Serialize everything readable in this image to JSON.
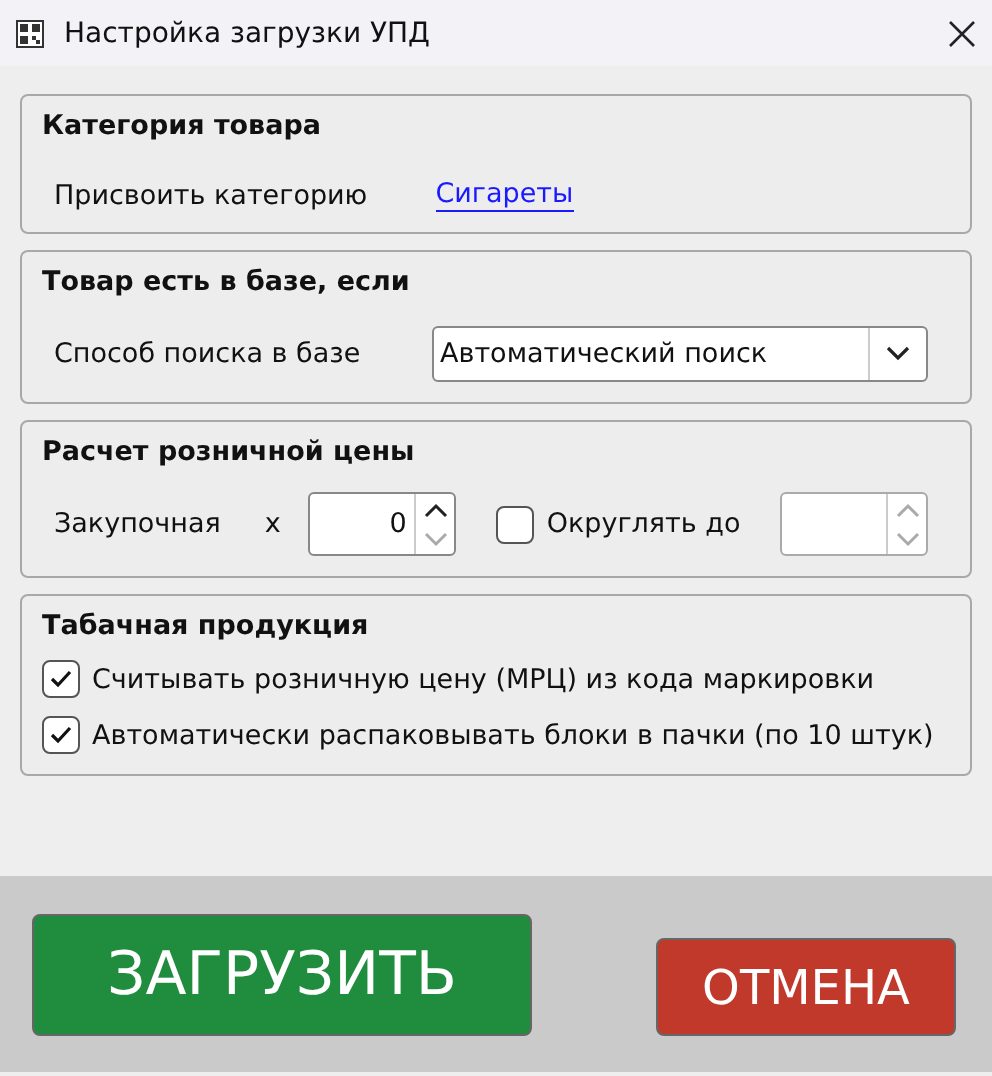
{
  "window": {
    "title": "Настройка загрузки УПД"
  },
  "sections": [
    {
      "title": "Категория товара",
      "kind": "link",
      "label": "Присвоить категорию",
      "link": "Сигареты"
    },
    {
      "title": "Товар есть в базе, если",
      "kind": "dropdown",
      "label": "Способ поиска в базе",
      "value": "Автоматический поиск"
    },
    {
      "title": "Расчет розничной цены",
      "kind": "price",
      "label": "Закупочная",
      "operator": "x",
      "multiplier": {
        "value": "0",
        "disabled": false
      },
      "round": {
        "label": "Округлять до",
        "checked": false,
        "disabled": true
      }
    },
    {
      "title": "Табачная продукция",
      "kind": "checks",
      "options": [
        {
          "label": "Считывать розничную цену (МРЦ) из кода маркировки",
          "checked": true
        },
        {
          "label": "Автоматически распаковывать блоки в пачки (по 10 штук)",
          "checked": true
        }
      ]
    }
  ],
  "buttons": [
    {
      "label": "ЗАГРУЗИТЬ",
      "kind": "primary"
    },
    {
      "label": "ОТМЕНА",
      "kind": "cancel"
    }
  ]
}
